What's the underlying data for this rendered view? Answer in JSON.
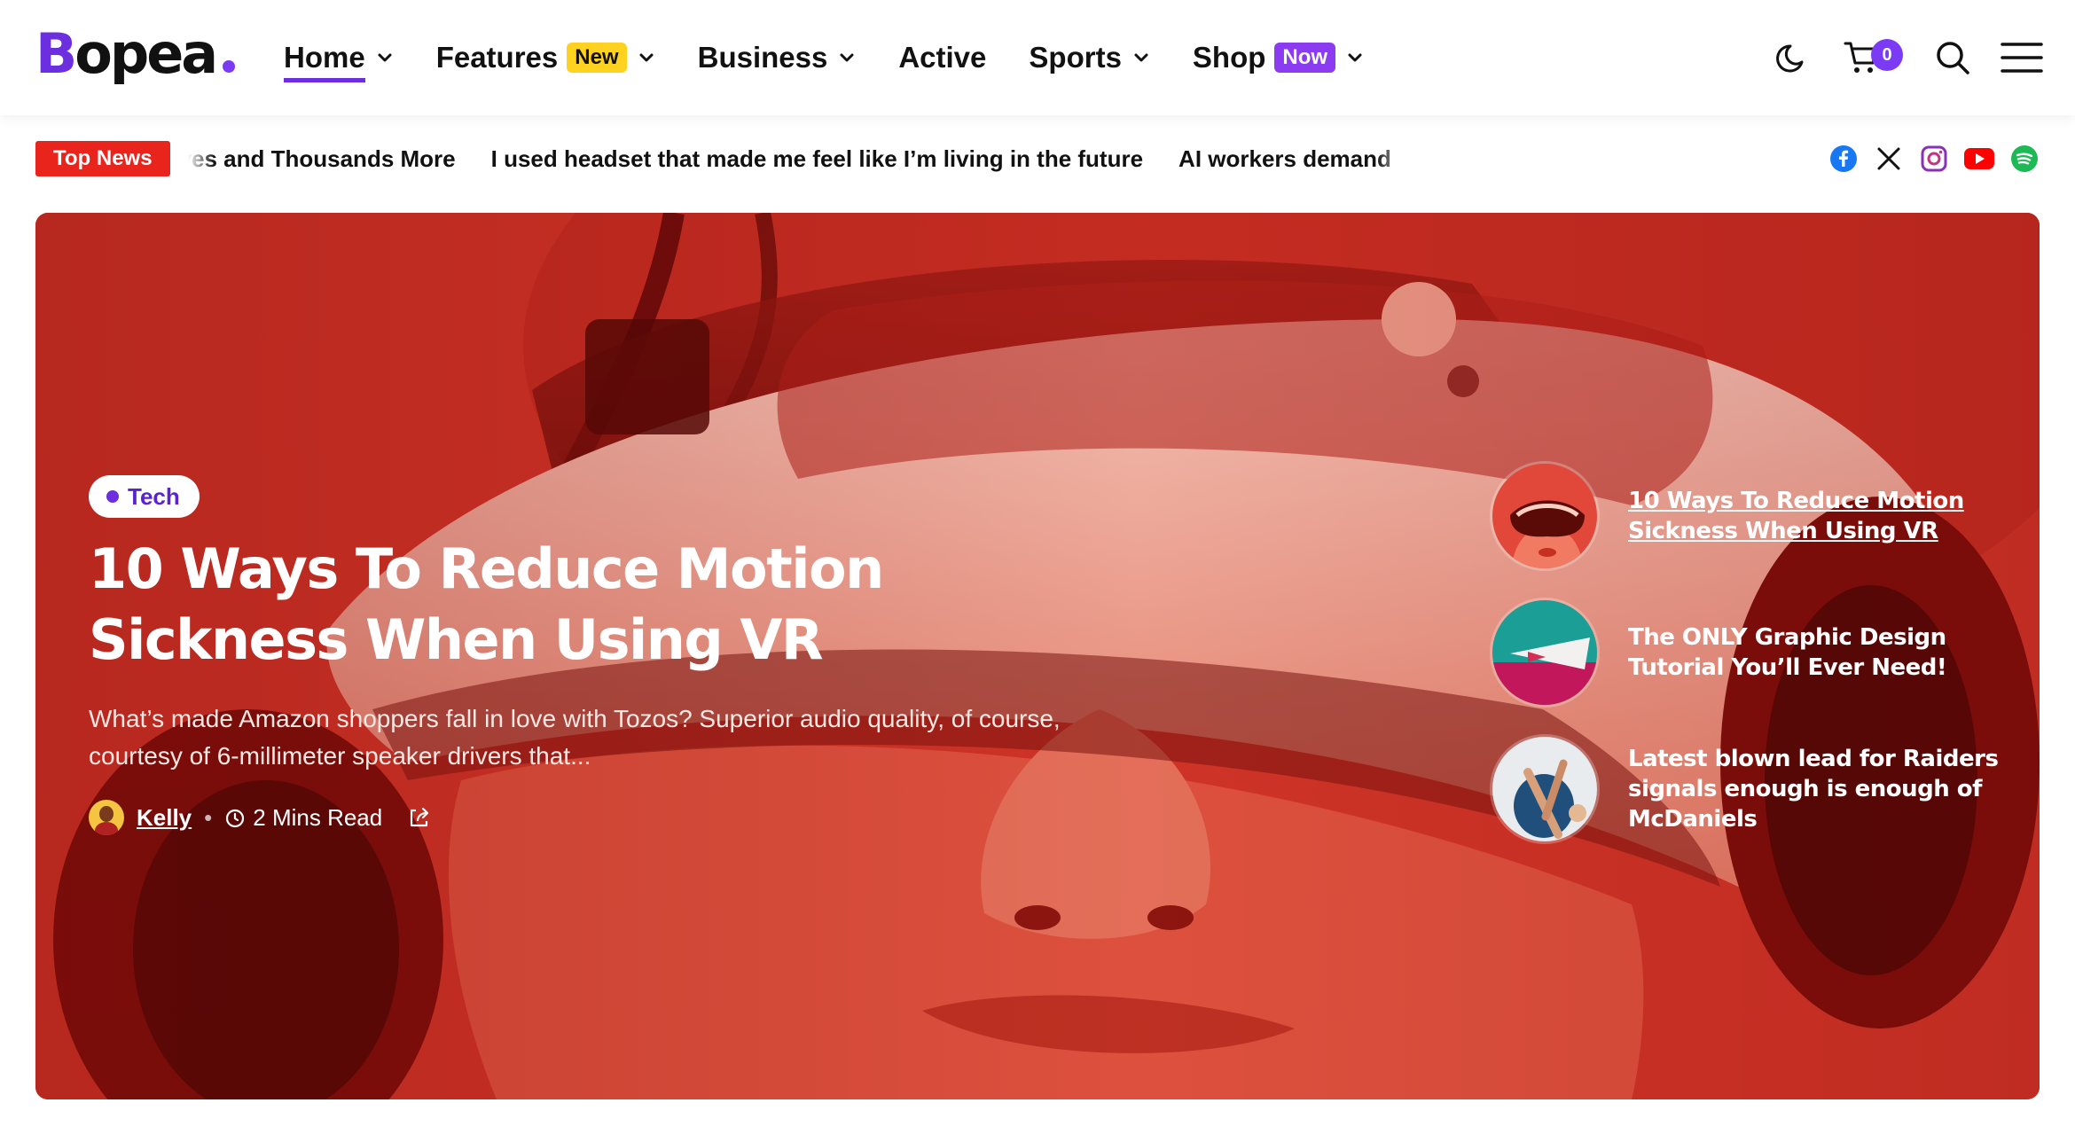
{
  "brand": {
    "logo_first": "B",
    "logo_rest": "opea"
  },
  "nav": {
    "items": [
      {
        "label": "Home",
        "has_menu": true,
        "active": true
      },
      {
        "label": "Features",
        "badge": "New",
        "has_menu": true
      },
      {
        "label": "Business",
        "has_menu": true
      },
      {
        "label": "Active",
        "has_menu": false
      },
      {
        "label": "Sports",
        "has_menu": true
      },
      {
        "label": "Shop",
        "badge": "Now",
        "has_menu": true
      }
    ]
  },
  "tools": {
    "cart_count": "0",
    "icons": [
      "moon-icon",
      "cart-icon",
      "search-icon",
      "menu-icon"
    ]
  },
  "ticker": {
    "label": "Top News",
    "items": [
      "ves and Thousands More",
      "I used headset that made me feel like I’m living in the future",
      "AI workers demand"
    ]
  },
  "socials": [
    "facebook-icon",
    "x-icon",
    "instagram-icon",
    "youtube-icon",
    "spotify-icon"
  ],
  "hero": {
    "category": "Tech",
    "title": "10 Ways To Reduce Motion Sickness When Using VR",
    "excerpt": "What’s made Amazon shoppers fall in love with Tozos? Superior audio quality, of course, courtesy of 6-millimeter speaker drivers that...",
    "author": "Kelly",
    "read_time": "2 Mins Read"
  },
  "side_posts": [
    {
      "title": "10 Ways To Reduce Motion Sickness When Using VR"
    },
    {
      "title": "The ONLY Graphic Design Tutorial You’ll Ever Need!"
    },
    {
      "title": "Latest blown lead for Raiders signals enough is enough of McDaniels"
    }
  ],
  "colors": {
    "accent": "#6b2fe0",
    "top_news": "#e8241c",
    "new_badge": "#ffd21f",
    "now_badge": "#8b3cf0",
    "hero_tint": "#d9372b"
  }
}
